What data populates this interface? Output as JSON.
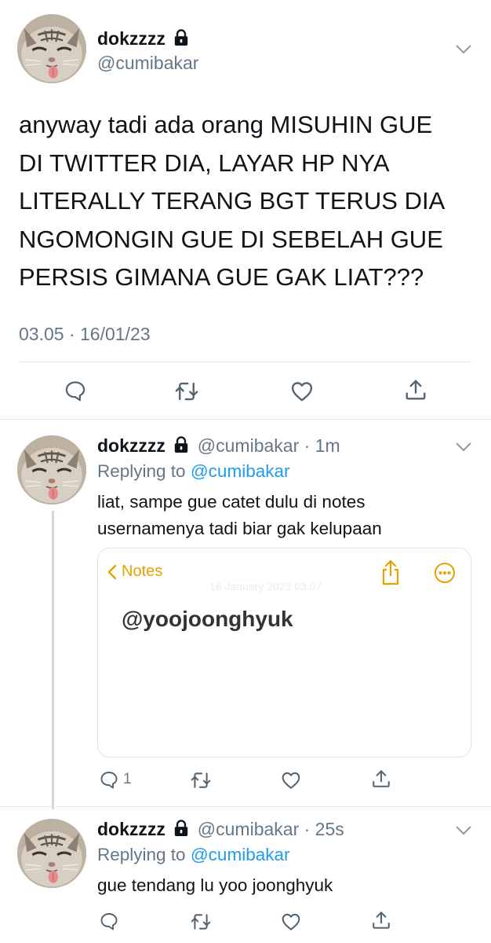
{
  "main_tweet": {
    "author_name": "dokzzzz",
    "handle": "@cumibakar",
    "text_lines": [
      "anyway tadi ada orang MISUHIN GUE",
      "DI TWITTER DIA, LAYAR HP NYA",
      "LITERALLY TERANG BGT TERUS DIA",
      "NGOMONGIN GUE DI SEBELAH GUE",
      "PERSIS GIMANA GUE GAK LIAT???"
    ],
    "timestamp": "03.05 · 16/01/23",
    "actions": [
      "reply-icon",
      "retweet-icon",
      "like-icon",
      "share-icon"
    ]
  },
  "reply1": {
    "author_name": "dokzzzz",
    "handle_time": "@cumibakar · 1m",
    "replying_prefix": "Replying to",
    "replying_to": "@cumibakar",
    "text_lines": [
      "liat, sampe gue catet dulu di notes",
      "usernamenya tadi biar gak kelupaan"
    ],
    "attachment": {
      "back_label": "Notes",
      "date_text": "16 January 2023 03.07",
      "body_text": "@yoojoonghyuk"
    },
    "reply_count": "1"
  },
  "reply2": {
    "author_name": "dokzzzz",
    "handle_time": "@cumibakar · 25s",
    "replying_prefix": "Replying to",
    "replying_to": "@cumibakar",
    "text": "gue tendang lu yoo joonghyuk"
  },
  "colors": {
    "text": "#0f1419",
    "secondary": "#657786",
    "link": "#1d9bf0",
    "notes_accent": "#e5a200",
    "divider": "#e1e8ed"
  }
}
